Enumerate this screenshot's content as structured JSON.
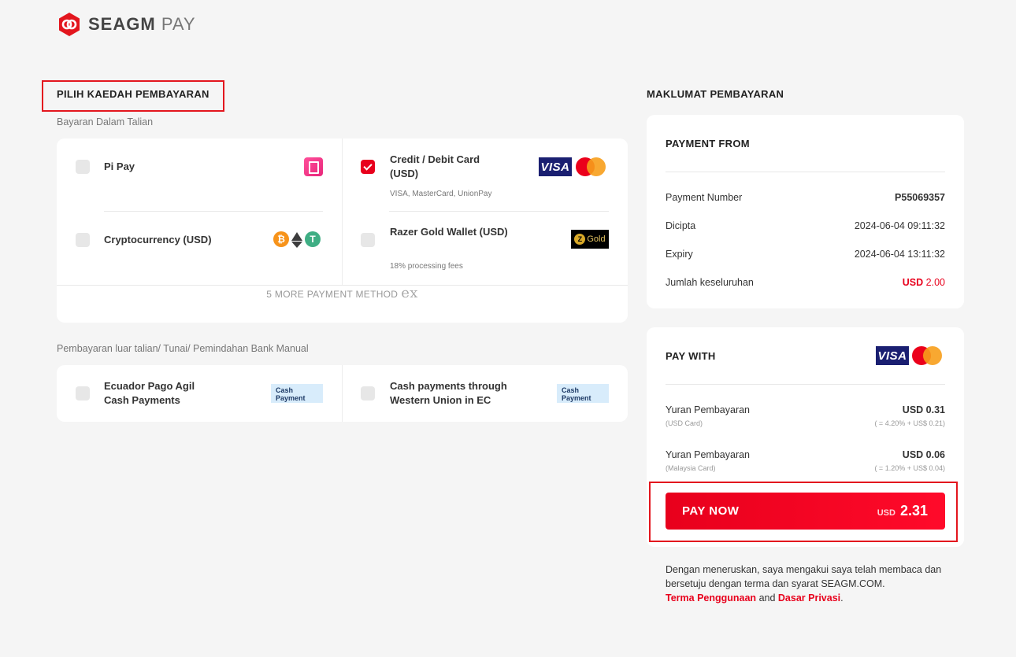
{
  "header": {
    "brand_main": "SEAGM",
    "brand_pay": "PAY"
  },
  "left": {
    "title": "PILIH KAEDAH PEMBAYARAN",
    "online_label": "Bayaran Dalam Talian",
    "online_methods": [
      {
        "name": "Pi Pay",
        "sub": "",
        "checked": false,
        "icon": "pipay-icon"
      },
      {
        "name": "Credit / Debit Card (USD)",
        "sub": "VISA, MasterCard, UnionPay",
        "checked": true,
        "icon": "visa-mastercard-icon"
      },
      {
        "name": "Cryptocurrency (USD)",
        "sub": "",
        "checked": false,
        "icon": "crypto-icons"
      },
      {
        "name": "Razer Gold Wallet (USD)",
        "sub": "18% processing fees",
        "checked": false,
        "icon": "razer-gold-icon"
      }
    ],
    "more_label": "5 MORE PAYMENT METHOD",
    "more_suffix": "ex",
    "offline_label": "Pembayaran luar talian/ Tunai/ Pemindahan Bank Manual",
    "offline_methods": [
      {
        "name": "Ecuador Pago Agil Cash Payments",
        "badge": "Cash Payment",
        "checked": false
      },
      {
        "name": "Cash payments through Western Union in EC",
        "badge": "Cash Payment",
        "checked": false
      }
    ]
  },
  "right": {
    "title": "MAKLUMAT PEMBAYARAN",
    "payment_from": {
      "title": "PAYMENT FROM",
      "rows": [
        {
          "label": "Payment Number",
          "value": "P55069357"
        },
        {
          "label": "Dicipta",
          "value": "2024-06-04 09:11:32"
        },
        {
          "label": "Expiry",
          "value": "2024-06-04 13:11:32"
        },
        {
          "label": "Jumlah keseluruhan",
          "currency": "USD",
          "value": "2.00"
        }
      ]
    },
    "pay_with": {
      "title": "PAY WITH",
      "visa_text": "VISA",
      "fees": [
        {
          "label": "Yuran Pembayaran",
          "sub": "(USD Card)",
          "value": "USD 0.31",
          "detail": "( = 4.20% + US$ 0.21)"
        },
        {
          "label": "Yuran Pembayaran",
          "sub": "(Malaysia Card)",
          "value": "USD 0.06",
          "detail": "( = 1.20% + US$ 0.04)"
        }
      ],
      "button_label": "PAY NOW",
      "button_currency": "USD",
      "button_amount": "2.31"
    },
    "terms": {
      "text": "Dengan meneruskan, saya mengakui saya telah membaca dan bersetuju dengan terma dan syarat SEAGM.COM.",
      "link1": "Terma Penggunaan",
      "and": "and",
      "link2": "Dasar Privasi",
      "end": "."
    }
  },
  "colors": {
    "accent": "#e8001c",
    "visa": "#1a1f71",
    "background": "#f5f5f5"
  }
}
